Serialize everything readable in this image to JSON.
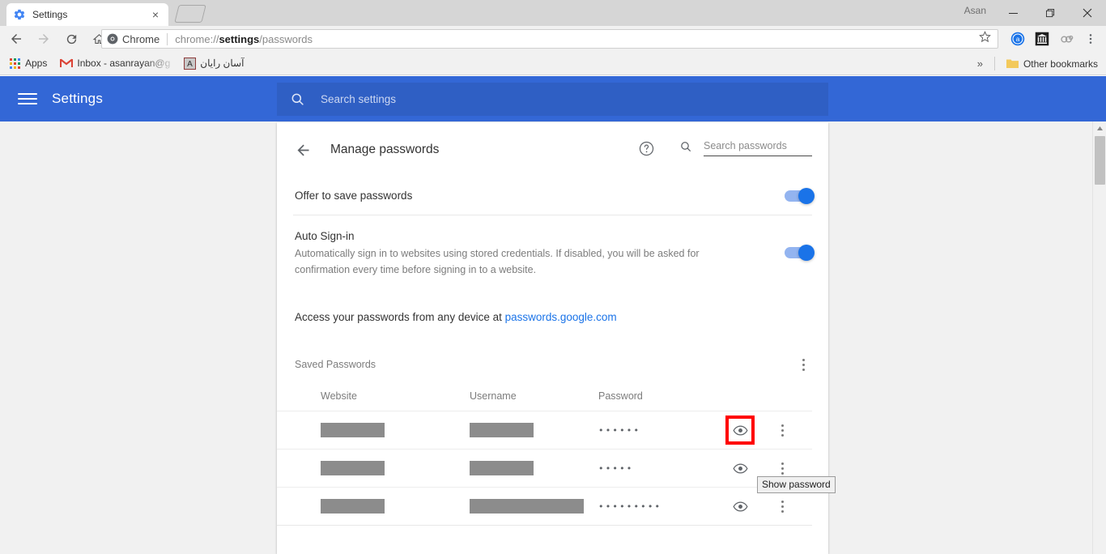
{
  "browser": {
    "tab": {
      "title": "Settings",
      "favicon": "settings-gear-icon",
      "close": "×"
    },
    "window_user": "Asan",
    "controls": {
      "minimize": "─",
      "maximize": "❐",
      "close": "✕"
    },
    "omnibox": {
      "chip_label": "Chrome",
      "url_prefix": "chrome://",
      "url_bold": "settings",
      "url_suffix": "/passwords"
    },
    "bookmarks": [
      {
        "label": "Apps",
        "icon": "apps-grid-icon"
      },
      {
        "label": "Inbox - asanrayan@g",
        "icon": "gmail-icon"
      },
      {
        "label": "آسان رایان",
        "icon": "asan-rayan-icon"
      }
    ],
    "bookmarks_overflow": "»",
    "other_bookmarks": "Other bookmarks",
    "extensions": [
      "avast-icon",
      "bank-icon",
      "chain-links-icon",
      "chrome-menu-icon"
    ]
  },
  "settings_header": {
    "title": "Settings",
    "menu_icon": "hamburger-icon",
    "search_placeholder": "Search settings",
    "accent_color": "#3367d6"
  },
  "subpage": {
    "title": "Manage passwords",
    "back_icon": "back-arrow-icon",
    "help_icon": "help-circle-icon",
    "search": {
      "icon": "search-icon",
      "placeholder": "Search passwords",
      "value": ""
    }
  },
  "settings": {
    "offer_to_save": {
      "label": "Offer to save passwords",
      "toggle": "on"
    },
    "auto_signin": {
      "label": "Auto Sign-in",
      "description": "Automatically sign in to websites using stored credentials. If disabled, you will be asked for confirmation every time before signing in to a website.",
      "toggle": "on"
    },
    "access_note": {
      "text": "Access your passwords from any device at ",
      "link": "passwords.google.com"
    }
  },
  "saved_passwords": {
    "section_title": "Saved Passwords",
    "menu_icon": "kebab-menu-icon",
    "columns": [
      "Website",
      "Username",
      "Password"
    ],
    "rows": [
      {
        "website_width": 79,
        "username_width": 79,
        "password": "••••••",
        "eye_icon": "eye-icon",
        "menu_icon": "kebab-menu-icon",
        "highlighted": true
      },
      {
        "website_width": 79,
        "username_width": 79,
        "password": "•••••",
        "eye_icon": "eye-icon",
        "menu_icon": "kebab-menu-icon",
        "highlighted": false
      },
      {
        "website_width": 79,
        "username_width": 141,
        "password": "•••••••••",
        "eye_icon": "eye-icon",
        "menu_icon": "kebab-menu-icon",
        "highlighted": false
      }
    ]
  },
  "tooltip": {
    "text": "Show password"
  },
  "colors": {
    "highlight_red": "#ff0000",
    "toggle_on": "#1a73e8",
    "link_blue": "#1a73e8",
    "header_blue": "#3367d6"
  }
}
